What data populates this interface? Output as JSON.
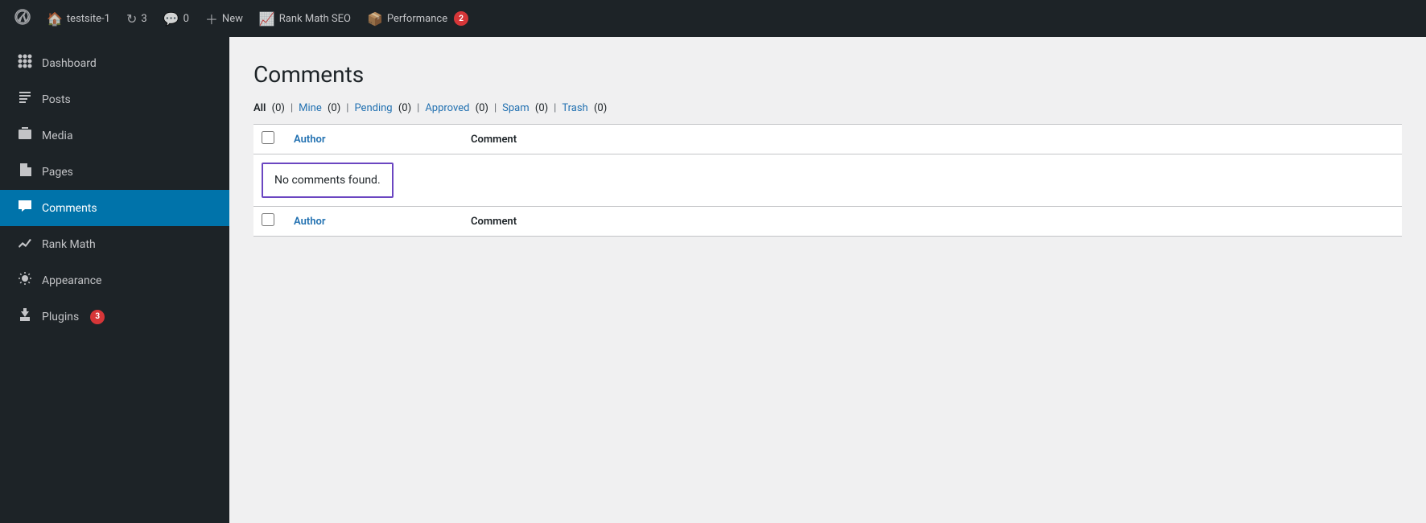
{
  "adminBar": {
    "items": [
      {
        "id": "wp-logo",
        "icon": "wp",
        "label": ""
      },
      {
        "id": "site-name",
        "icon": "home",
        "label": "testsite-1"
      },
      {
        "id": "updates",
        "icon": "refresh",
        "label": "3",
        "hasBadge": false
      },
      {
        "id": "comments",
        "icon": "comment",
        "label": "0",
        "hasBadge": false
      },
      {
        "id": "new",
        "icon": "plus",
        "label": "New"
      },
      {
        "id": "rank-math-seo",
        "icon": "chart",
        "label": "Rank Math SEO"
      },
      {
        "id": "performance",
        "icon": "perf",
        "label": "Performance",
        "badge": "2"
      }
    ]
  },
  "sidebar": {
    "items": [
      {
        "id": "dashboard",
        "icon": "dashboard",
        "label": "Dashboard"
      },
      {
        "id": "posts",
        "icon": "posts",
        "label": "Posts"
      },
      {
        "id": "media",
        "icon": "media",
        "label": "Media"
      },
      {
        "id": "pages",
        "icon": "pages",
        "label": "Pages"
      },
      {
        "id": "comments",
        "icon": "comments",
        "label": "Comments",
        "active": true
      },
      {
        "id": "rank-math",
        "icon": "rankmath",
        "label": "Rank Math"
      },
      {
        "id": "appearance",
        "icon": "appearance",
        "label": "Appearance"
      },
      {
        "id": "plugins",
        "icon": "plugins",
        "label": "Plugins",
        "badge": "3"
      }
    ]
  },
  "main": {
    "title": "Comments",
    "filters": [
      {
        "id": "all",
        "label": "All",
        "count": "(0)",
        "current": true,
        "sep": true
      },
      {
        "id": "mine",
        "label": "Mine",
        "count": "(0)",
        "current": false,
        "sep": true
      },
      {
        "id": "pending",
        "label": "Pending",
        "count": "(0)",
        "current": false,
        "sep": true
      },
      {
        "id": "approved",
        "label": "Approved",
        "count": "(0)",
        "current": false,
        "sep": true
      },
      {
        "id": "spam",
        "label": "Spam",
        "count": "(0)",
        "current": false,
        "sep": true
      },
      {
        "id": "trash",
        "label": "Trash",
        "count": "(0)",
        "current": false,
        "sep": false
      }
    ],
    "table": {
      "columns": [
        {
          "id": "cb",
          "label": ""
        },
        {
          "id": "author",
          "label": "Author"
        },
        {
          "id": "comment",
          "label": "Comment"
        }
      ],
      "noCommentsText": "No comments found.",
      "footerAuthorLabel": "Author",
      "footerCommentLabel": "Comment"
    }
  }
}
